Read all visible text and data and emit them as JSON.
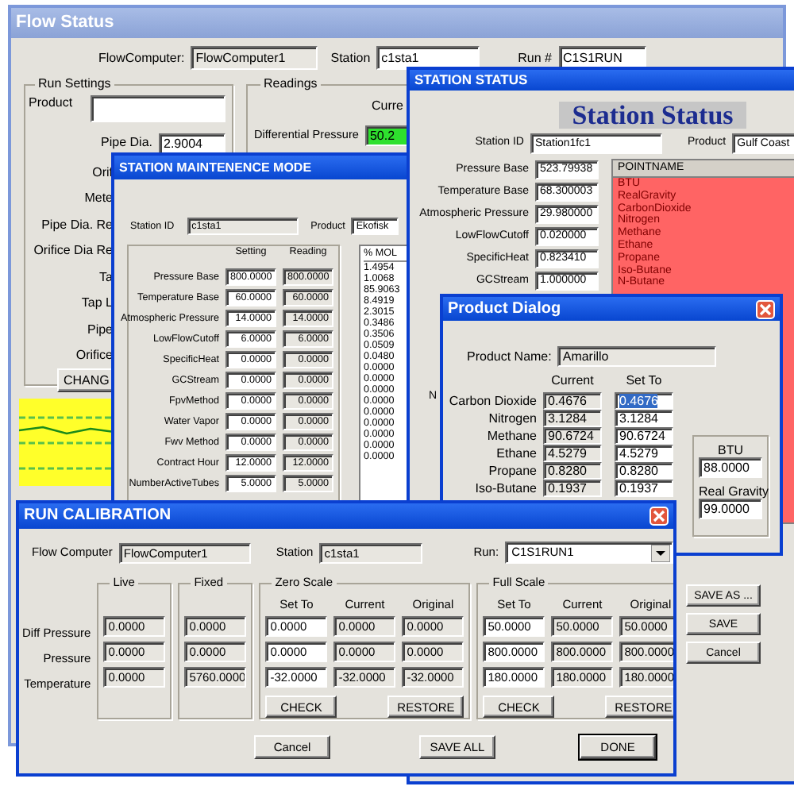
{
  "flow_status": {
    "title": "Flow Status",
    "flow_computer_label": "FlowComputer:",
    "flow_computer": "FlowComputer1",
    "station_label": "Station",
    "station": "c1sta1",
    "run_label": "Run #",
    "run": "C1S1RUN",
    "run_settings": {
      "title": "Run Settings",
      "product_label": "Product",
      "pipe_dia_label": "Pipe Dia.",
      "pipe_dia": "2.9004",
      "labels": [
        "Orif",
        "Mete",
        "Pipe Dia. Re",
        "Orifice Dia Re",
        "Ta",
        "Tap L",
        "Pipe",
        "Orifice"
      ],
      "button": "CHANG"
    },
    "readings": {
      "title": "Readings",
      "column": "Curre",
      "label": "Differential Pressure",
      "value": "50.2"
    }
  },
  "station_maintenance": {
    "title": "STATION MAINTENENCE MODE",
    "station_id_label": "Station ID",
    "station_id": "c1sta1",
    "product_label": "Product",
    "product": "Ekofisk",
    "columns": [
      "Setting",
      "Reading"
    ],
    "rows": [
      {
        "label": "Pressure Base",
        "setting": "800.0000",
        "reading": "800.0000"
      },
      {
        "label": "Temperature Base",
        "setting": "60.0000",
        "reading": "60.0000"
      },
      {
        "label": "Atmospheric Pressure",
        "setting": "14.0000",
        "reading": "14.0000"
      },
      {
        "label": "LowFlowCutoff",
        "setting": "6.0000",
        "reading": "6.0000"
      },
      {
        "label": "SpecificHeat",
        "setting": "0.0000",
        "reading": "0.0000"
      },
      {
        "label": "GCStream",
        "setting": "0.0000",
        "reading": "0.0000"
      },
      {
        "label": "FpvMethod",
        "setting": "0.0000",
        "reading": "0.0000"
      },
      {
        "label": "Water Vapor",
        "setting": "0.0000",
        "reading": "0.0000"
      },
      {
        "label": "Fwv Method",
        "setting": "0.0000",
        "reading": "0.0000"
      },
      {
        "label": "Contract Hour",
        "setting": "12.0000",
        "reading": "12.0000"
      },
      {
        "label": "NumberActiveTubes",
        "setting": "5.0000",
        "reading": "5.0000"
      }
    ],
    "mol_header": "% MOL",
    "mol_values": [
      "1.4954",
      "1.0068",
      "85.9063",
      "8.4919",
      "2.3015",
      "0.3486",
      "0.3506",
      "0.0509",
      "0.0480",
      "0.0000",
      "0.0000",
      "0.0000",
      "0.0000",
      "0.0000",
      "0.0000",
      "0.0000",
      "0.0000",
      "0.0000"
    ]
  },
  "station_status": {
    "title": "STATION STATUS",
    "heading": "Station Status",
    "station_id_label": "Station ID",
    "station_id": "Station1fc1",
    "product_label": "Product",
    "product": "Gulf Coast",
    "fields": [
      {
        "label": "Pressure Base",
        "value": "523.79938"
      },
      {
        "label": "Temperature Base",
        "value": "68.300003"
      },
      {
        "label": "Atmospheric Pressure",
        "value": "29.980000"
      },
      {
        "label": "LowFlowCutoff",
        "value": "0.020000"
      },
      {
        "label": "SpecificHeat",
        "value": "0.823410"
      },
      {
        "label": "GCStream",
        "value": "1.000000"
      }
    ],
    "cut_label": "N",
    "point_header": "POINTNAME",
    "points": [
      "BTU",
      "RealGravity",
      "CarbonDioxide",
      "Nitrogen",
      "Methane",
      "Ethane",
      "Propane",
      "Iso-Butane",
      "N-Butane"
    ],
    "buttons": [
      "SAVE AS ...",
      "SAVE",
      "Cancel"
    ]
  },
  "product_dialog": {
    "title": "Product Dialog",
    "name_label": "Product Name:",
    "name": "Amarillo",
    "columns": [
      "Current",
      "Set To"
    ],
    "rows": [
      {
        "label": "Carbon Dioxide",
        "current": "0.4676",
        "set_to": "0.4676",
        "highlighted": true
      },
      {
        "label": "Nitrogen",
        "current": "3.1284",
        "set_to": "3.1284",
        "highlighted": false
      },
      {
        "label": "Methane",
        "current": "90.6724",
        "set_to": "90.6724",
        "highlighted": false
      },
      {
        "label": "Ethane",
        "current": "4.5279",
        "set_to": "4.5279",
        "highlighted": false
      },
      {
        "label": "Propane",
        "current": "0.8280",
        "set_to": "0.8280",
        "highlighted": false
      },
      {
        "label": "Iso-Butane",
        "current": "0.1937",
        "set_to": "0.1937",
        "highlighted": false
      }
    ],
    "btu_label": "BTU",
    "btu": "88.0000",
    "gravity_label": "Real Gravity",
    "gravity": "99.0000"
  },
  "run_calibration": {
    "title": "RUN CALIBRATION",
    "flow_computer_label": "Flow Computer",
    "flow_computer": "FlowComputer1",
    "station_label": "Station",
    "station": "c1sta1",
    "run_label": "Run:",
    "run": "C1S1RUN1",
    "row_labels": [
      "Diff Pressure",
      "Pressure",
      "Temperature"
    ],
    "live": {
      "title": "Live",
      "values": [
        "0.0000",
        "0.0000",
        "0.0000"
      ]
    },
    "fixed": {
      "title": "Fixed",
      "values": [
        "0.0000",
        "0.0000",
        "5760.0000"
      ]
    },
    "zero_scale": {
      "title": "Zero Scale",
      "columns": [
        "Set To",
        "Current",
        "Original"
      ],
      "values": [
        [
          "0.0000",
          "0.0000",
          "0.0000"
        ],
        [
          "0.0000",
          "0.0000",
          "0.0000"
        ],
        [
          "-32.0000",
          "-32.0000",
          "-32.0000"
        ]
      ],
      "buttons": [
        "CHECK",
        "RESTORE"
      ]
    },
    "full_scale": {
      "title": "Full Scale",
      "columns": [
        "Set To",
        "Current",
        "Original"
      ],
      "values": [
        [
          "50.0000",
          "50.0000",
          "50.0000"
        ],
        [
          "800.0000",
          "800.0000",
          "800.0000"
        ],
        [
          "180.0000",
          "180.0000",
          "180.0000"
        ]
      ],
      "buttons": [
        "CHECK",
        "RESTORE"
      ]
    },
    "buttons": [
      {
        "label": "Cancel",
        "default": false
      },
      {
        "label": "SAVE ALL",
        "default": false
      },
      {
        "label": "DONE",
        "default": true
      }
    ]
  }
}
